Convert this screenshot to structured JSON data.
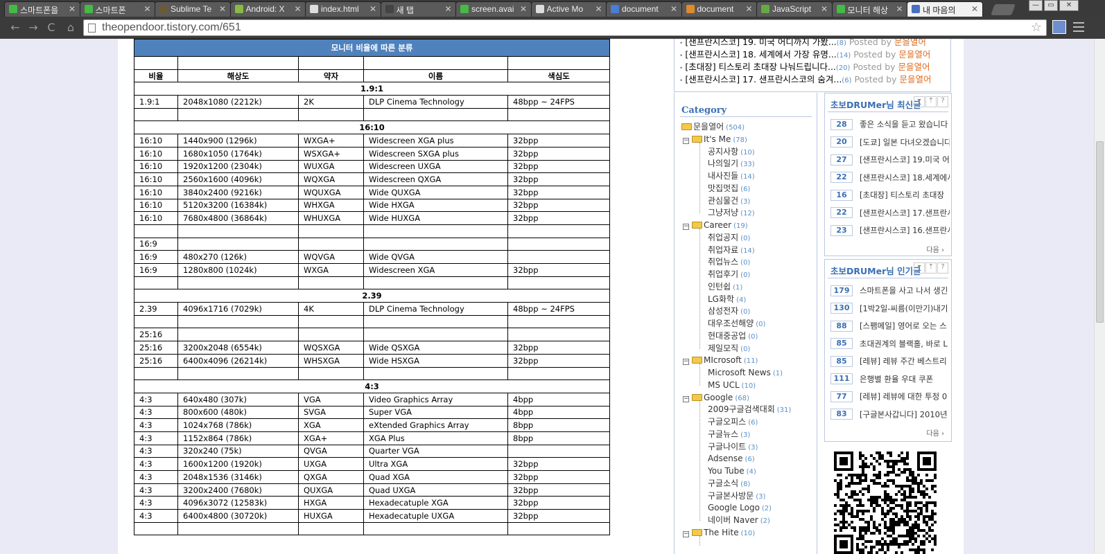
{
  "tabs": [
    {
      "label": "스마트폰을",
      "icon_color": "#44bb44",
      "active": false
    },
    {
      "label": "스마트폰",
      "icon_color": "#44bb44",
      "active": false
    },
    {
      "label": "Sublime Te",
      "icon_color": "#6a5a3a",
      "active": false
    },
    {
      "label": "Android: X",
      "icon_color": "#88bb44",
      "active": false
    },
    {
      "label": "index.html",
      "icon_color": "#dddddd",
      "active": false
    },
    {
      "label": "새 탭",
      "icon_color": "#444444",
      "active": false
    },
    {
      "label": "screen.avai",
      "icon_color": "#44bb44",
      "active": false
    },
    {
      "label": "Active Mo",
      "icon_color": "#dddddd",
      "active": false
    },
    {
      "label": "document",
      "icon_color": "#4a7dd4",
      "active": false
    },
    {
      "label": "document",
      "icon_color": "#e08a2a",
      "active": false
    },
    {
      "label": "JavaScript",
      "icon_color": "#66aa44",
      "active": false
    },
    {
      "label": "모니터 해상",
      "icon_color": "#44bb44",
      "active": false
    },
    {
      "label": "내 마음의",
      "icon_color": "#4a6fc0",
      "active": true
    }
  ],
  "tab_close": "✕",
  "window_controls": {
    "minimize": "—",
    "restore": "▭",
    "close": "✕"
  },
  "toolbar": {
    "back": "←",
    "forward": "→",
    "reload": "C",
    "home": "⌂",
    "star": "☆"
  },
  "url": "theopendoor.tistory.com/651",
  "table": {
    "title": "모니터 비율에 따른 분류",
    "headers": [
      "비율",
      "해상도",
      "약자",
      "이름",
      "색심도"
    ],
    "rows": [
      {
        "type": "group",
        "label": "1.9:1"
      },
      {
        "type": "data",
        "cells": [
          "1.9:1",
          "2048x1080 (2212k)",
          "2K",
          "DLP Cinema Technology",
          "48bpp ~ 24FPS"
        ]
      },
      {
        "type": "data",
        "cells": [
          "",
          "",
          "",
          "",
          ""
        ]
      },
      {
        "type": "group",
        "label": "16:10"
      },
      {
        "type": "data",
        "cells": [
          "16:10",
          "1440x900 (1296k)",
          "WXGA+",
          "Widescreen XGA plus",
          "32bpp"
        ]
      },
      {
        "type": "data",
        "cells": [
          "16:10",
          "1680x1050 (1764k)",
          "WSXGA+",
          "Widescreen SXGA plus",
          "32bpp"
        ]
      },
      {
        "type": "data",
        "cells": [
          "16:10",
          "1920x1200 (2304k)",
          "WUXGA",
          "Widescreen UXGA",
          "32bpp"
        ]
      },
      {
        "type": "data",
        "cells": [
          "16:10",
          "2560x1600 (4096k)",
          "WQXGA",
          "Widescreen QXGA",
          "32bpp"
        ]
      },
      {
        "type": "data",
        "cells": [
          "16:10",
          "3840x2400 (9216k)",
          "WQUXGA",
          "Wide QUXGA",
          "32bpp"
        ]
      },
      {
        "type": "data",
        "cells": [
          "16:10",
          "5120x3200 (16384k)",
          "WHXGA",
          "Wide HXGA",
          "32bpp"
        ]
      },
      {
        "type": "data",
        "cells": [
          "16:10",
          "7680x4800 (36864k)",
          "WHUXGA",
          "Wide HUXGA",
          "32bpp"
        ]
      },
      {
        "type": "data",
        "cells": [
          "",
          "",
          "",
          "",
          ""
        ]
      },
      {
        "type": "data",
        "cells": [
          "16:9",
          "",
          "",
          "",
          ""
        ]
      },
      {
        "type": "data",
        "cells": [
          "16:9",
          "480x270 (126k)",
          "WQVGA",
          "Wide QVGA",
          ""
        ]
      },
      {
        "type": "data",
        "cells": [
          "16:9",
          "1280x800 (1024k)",
          "WXGA",
          "Widescreen XGA",
          "32bpp"
        ]
      },
      {
        "type": "data",
        "cells": [
          "",
          "",
          "",
          "",
          ""
        ]
      },
      {
        "type": "group",
        "label": "2.39"
      },
      {
        "type": "data",
        "cells": [
          "2.39",
          "4096x1716 (7029k)",
          "4K",
          "DLP Cinema Technology",
          "48bpp ~ 24FPS"
        ]
      },
      {
        "type": "data",
        "cells": [
          "",
          "",
          "",
          "",
          ""
        ]
      },
      {
        "type": "data",
        "cells": [
          "25:16",
          "",
          "",
          "",
          ""
        ]
      },
      {
        "type": "data",
        "cells": [
          "25:16",
          "3200x2048 (6554k)",
          "WQSXGA",
          "Wide QSXGA",
          "32bpp"
        ]
      },
      {
        "type": "data",
        "cells": [
          "25:16",
          "6400x4096 (26214k)",
          "WHSXGA",
          "Wide HSXGA",
          "32bpp"
        ]
      },
      {
        "type": "data",
        "cells": [
          "",
          "",
          "",
          "",
          ""
        ]
      },
      {
        "type": "group",
        "label": "4:3"
      },
      {
        "type": "data",
        "cells": [
          "4:3",
          "640x480 (307k)",
          "VGA",
          "Video Graphics Array",
          "4bpp"
        ]
      },
      {
        "type": "data",
        "cells": [
          "4:3",
          "800x600 (480k)",
          "SVGA",
          "Super VGA",
          "4bpp"
        ]
      },
      {
        "type": "data",
        "cells": [
          "4:3",
          "1024x768 (786k)",
          "XGA",
          "eXtended Graphics Array",
          "8bpp"
        ]
      },
      {
        "type": "data",
        "cells": [
          "4:3",
          "1152x864 (786k)",
          "XGA+",
          "XGA Plus",
          "8bpp"
        ]
      },
      {
        "type": "data",
        "cells": [
          "4:3",
          "320x240 (75k)",
          "QVGA",
          "Quarter VGA",
          ""
        ]
      },
      {
        "type": "data",
        "cells": [
          "4:3",
          "1600x1200 (1920k)",
          "UXGA",
          "Ultra XGA",
          "32bpp"
        ]
      },
      {
        "type": "data",
        "cells": [
          "4:3",
          "2048x1536 (3146k)",
          "QXGA",
          "Quad XGA",
          "32bpp"
        ]
      },
      {
        "type": "data",
        "cells": [
          "4:3",
          "3200x2400 (7680k)",
          "QUXGA",
          "Quad UXGA",
          "32bpp"
        ]
      },
      {
        "type": "data",
        "cells": [
          "4:3",
          "4096x3072 (12583k)",
          "HXGA",
          "Hexadecatuple XGA",
          "32bpp"
        ]
      },
      {
        "type": "data",
        "cells": [
          "4:3",
          "6400x4800 (30720k)",
          "HUXGA",
          "Hexadecatuple UXGA",
          "32bpp"
        ]
      },
      {
        "type": "data",
        "cells": [
          "",
          "",
          "",
          "",
          ""
        ]
      }
    ]
  },
  "recent_posts": [
    {
      "title": "[샌프란시스코] 19. 미국 어디까지 가봤...",
      "count": "(8)",
      "posted": "Posted by",
      "author": "문을열어"
    },
    {
      "title": "[샌프란시스코] 18. 세계에서 가장 유명...",
      "count": "(14)",
      "posted": "Posted by",
      "author": "문을열어"
    },
    {
      "title": "[초대장] 티스토리 초대장 나눠드립니다...",
      "count": "(20)",
      "posted": "Posted by",
      "author": "문을열어"
    },
    {
      "title": "[샌프란시스코] 17. 샌프란시스코의 숨겨...",
      "count": "(6)",
      "posted": "Posted by",
      "author": "문을열어"
    }
  ],
  "category": {
    "title": "Category",
    "root": {
      "label": "문을열어",
      "count": "(504)"
    },
    "items": [
      {
        "label": "It's Me",
        "count": "(78)",
        "level": 1
      },
      {
        "label": "공지사항",
        "count": "(10)",
        "level": 2
      },
      {
        "label": "나의일기",
        "count": "(33)",
        "level": 2
      },
      {
        "label": "내사진들",
        "count": "(14)",
        "level": 2
      },
      {
        "label": "맛집멋집",
        "count": "(6)",
        "level": 2
      },
      {
        "label": "관심물건",
        "count": "(3)",
        "level": 2
      },
      {
        "label": "그냥저냥",
        "count": "(12)",
        "level": 2
      },
      {
        "label": "Career",
        "count": "(19)",
        "level": 1
      },
      {
        "label": "취업공지",
        "count": "(0)",
        "level": 2
      },
      {
        "label": "취업자료",
        "count": "(14)",
        "level": 2
      },
      {
        "label": "취업뉴스",
        "count": "(0)",
        "level": 2
      },
      {
        "label": "취업후기",
        "count": "(0)",
        "level": 2
      },
      {
        "label": "인턴쉽",
        "count": "(1)",
        "level": 2
      },
      {
        "label": "LG화학",
        "count": "(4)",
        "level": 2
      },
      {
        "label": "삼성전자",
        "count": "(0)",
        "level": 2
      },
      {
        "label": "대우조선해양",
        "count": "(0)",
        "level": 2
      },
      {
        "label": "현대중공업",
        "count": "(0)",
        "level": 2
      },
      {
        "label": "제일모직",
        "count": "(0)",
        "level": 2
      },
      {
        "label": "MIcrosoft",
        "count": "(11)",
        "level": 1
      },
      {
        "label": "Microsoft News",
        "count": "(1)",
        "level": 2
      },
      {
        "label": "MS UCL",
        "count": "(10)",
        "level": 2
      },
      {
        "label": "Google",
        "count": "(68)",
        "level": 1
      },
      {
        "label": "2009구글검색대회",
        "count": "(31)",
        "level": 2
      },
      {
        "label": "구글오피스",
        "count": "(6)",
        "level": 2
      },
      {
        "label": "구글뉴스",
        "count": "(3)",
        "level": 2
      },
      {
        "label": "구글나이트",
        "count": "(3)",
        "level": 2
      },
      {
        "label": "Adsense",
        "count": "(6)",
        "level": 2
      },
      {
        "label": "You Tube",
        "count": "(4)",
        "level": 2
      },
      {
        "label": "구글소식",
        "count": "(8)",
        "level": 2
      },
      {
        "label": "구글본사방문",
        "count": "(3)",
        "level": 2
      },
      {
        "label": "Google Logo",
        "count": "(2)",
        "level": 2
      },
      {
        "label": "네이버 Naver",
        "count": "(2)",
        "level": 2
      },
      {
        "label": "The Hite",
        "count": "(10)",
        "level": 1
      }
    ]
  },
  "latest_widget": {
    "title": "초보DRUMer님 최신글",
    "controls": [
      "▾",
      "⇡",
      "?"
    ],
    "items": [
      {
        "num": "28",
        "text": "좋은 소식을 듣고 왔습니다"
      },
      {
        "num": "20",
        "text": "[도쿄] 일본 다녀오겠습니다"
      },
      {
        "num": "27",
        "text": "[샌프란시스코] 19.미국 어"
      },
      {
        "num": "22",
        "text": "[샌프란시스코] 18.세계에서"
      },
      {
        "num": "16",
        "text": "[초대장] 티스토리 초대장"
      },
      {
        "num": "22",
        "text": "[샌프란시스코] 17.샌프란시"
      },
      {
        "num": "23",
        "text": "[샌프란시스코] 16.샌프란시"
      }
    ],
    "more": "다음 ›"
  },
  "popular_widget": {
    "title": "초보DRUMer님 인기글",
    "controls": [
      "▾",
      "⇡",
      "?"
    ],
    "items": [
      {
        "num": "179",
        "text": "스마트폰을 사고 나서 생긴"
      },
      {
        "num": "130",
        "text": "[1박2일-씨름(이만기)내기"
      },
      {
        "num": "88",
        "text": "[스팸메일] 영어로 오는 스"
      },
      {
        "num": "85",
        "text": "초대권계의 블랙홀, 바로 L"
      },
      {
        "num": "85",
        "text": "[레뷰] 레뷰 주간 베스트리"
      },
      {
        "num": "111",
        "text": "은행별 환율 우대 쿠폰"
      },
      {
        "num": "77",
        "text": "[레뷰] 레뷰에 대한 투정 0"
      },
      {
        "num": "83",
        "text": "[구글본사갑니다] 2010년 C"
      }
    ],
    "more": "다음 ›"
  },
  "colors": {
    "accent": "#4f81bd",
    "link_blue": "#3a6fb4",
    "author_orange": "#e06d1e"
  }
}
